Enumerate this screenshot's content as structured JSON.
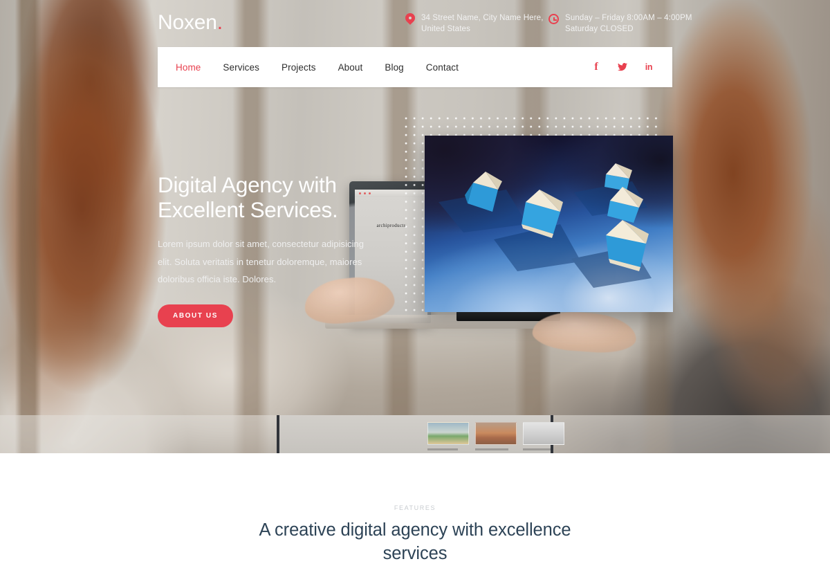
{
  "brand": {
    "name": "Noxen",
    "dot": ".",
    "accent_color": "#e8414f"
  },
  "topbar": {
    "address": {
      "icon": "map-pin-icon",
      "line1": "34 Street Name, City Name Here,",
      "line2": "United States"
    },
    "hours": {
      "icon": "clock-icon",
      "line1": "Sunday – Friday 8:00AM – 4:00PM",
      "line2": "Saturday CLOSED"
    }
  },
  "nav": {
    "items": [
      {
        "label": "Home",
        "active": true
      },
      {
        "label": "Services",
        "active": false
      },
      {
        "label": "Projects",
        "active": false
      },
      {
        "label": "About",
        "active": false
      },
      {
        "label": "Blog",
        "active": false
      },
      {
        "label": "Contact",
        "active": false
      }
    ],
    "social": [
      {
        "icon": "facebook-icon",
        "glyph": "f"
      },
      {
        "icon": "twitter-icon",
        "glyph": "🐦"
      },
      {
        "icon": "linkedin-icon",
        "glyph": "in"
      }
    ]
  },
  "hero": {
    "title_line1": "Digital Agency with",
    "title_line2": "Excellent Services.",
    "paragraph": "Lorem ipsum dolor sit amet, consectetur adipisicing elit. Soluta veritatis in tenetur doloremque, maiores doloribus officia iste. Dolores.",
    "cta_label": "ABOUT US",
    "feature_image_alt": "blue origami paper boats on gradient blue surface",
    "laptop_site_name": "archiproducts"
  },
  "features": {
    "eyebrow": "FEATURES",
    "title_line1": "A creative digital agency with excellence",
    "title_line2": "services"
  },
  "colors": {
    "accent": "#e8414f",
    "heading_navy": "#2d4356",
    "eyebrow_gray": "#c8ccd0",
    "nav_bg": "#ffffff"
  }
}
